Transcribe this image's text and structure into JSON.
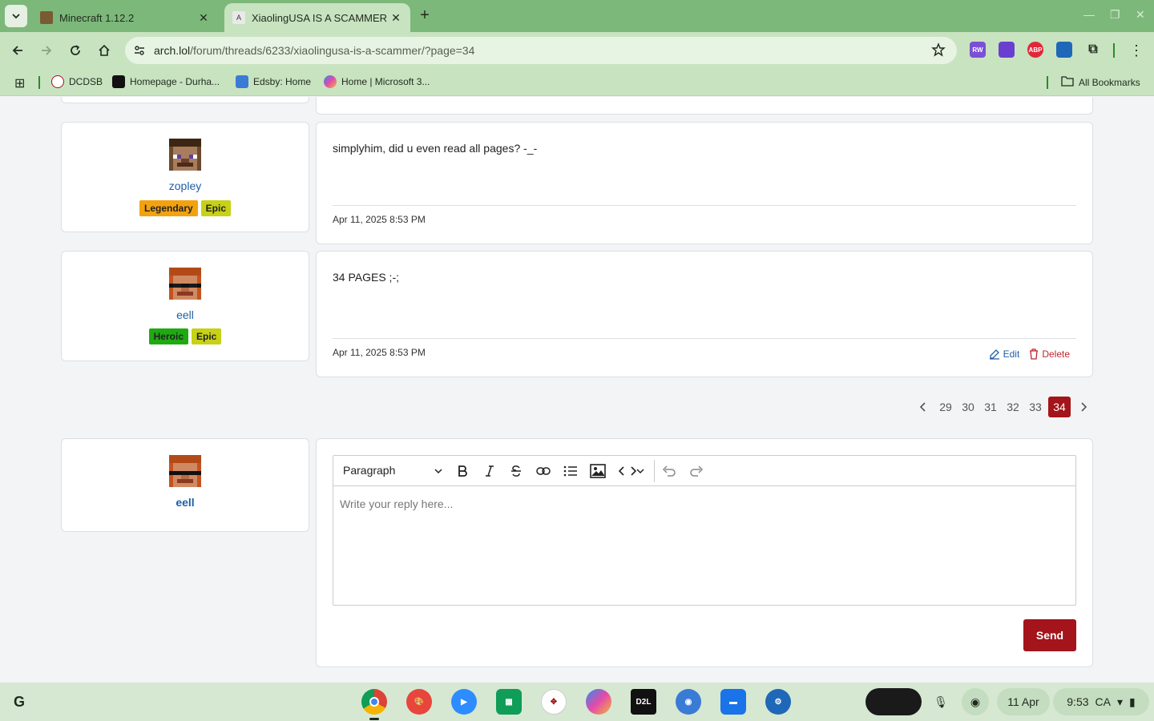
{
  "browser": {
    "tabs": [
      {
        "title": "Minecraft 1.12.2",
        "active": false
      },
      {
        "title": "XiaolingUSA IS A SCAMMER - A",
        "active": true
      }
    ],
    "url_host": "arch.lol",
    "url_path": "/forum/threads/6233/xiaolingusa-is-a-scammer/?page=34",
    "bookmarks": [
      "DCDSB",
      "Homepage - Durha...",
      "Edsby: Home",
      "Home | Microsoft 3..."
    ],
    "all_bookmarks_label": "All Bookmarks",
    "extensions": [
      "RW",
      "",
      "ABP",
      "",
      ""
    ]
  },
  "posts": [
    {
      "username": "zopley",
      "badges": [
        {
          "label": "Legendary",
          "color": "#f3a20f"
        },
        {
          "label": "Epic",
          "color": "#c7d115"
        }
      ],
      "text": "simplyhim, did u even read all pages? -_-",
      "date": "Apr 11, 2025 8:53 PM"
    },
    {
      "username": "eell",
      "badges": [
        {
          "label": "Heroic",
          "color": "#1faa12"
        },
        {
          "label": "Epic",
          "color": "#c7d115"
        }
      ],
      "text": "34 PAGES ;-;",
      "date": "Apr 11, 2025 8:53 PM",
      "edit_label": "Edit",
      "delete_label": "Delete"
    }
  ],
  "pagination": {
    "pages": [
      "29",
      "30",
      "31",
      "32",
      "33",
      "34"
    ],
    "current": "34"
  },
  "reply": {
    "username": "eell",
    "format_select": "Paragraph",
    "placeholder": "Write your reply here...",
    "send_label": "Send"
  },
  "shelf": {
    "apps": [
      "Chrome",
      "Palette",
      "Zoom",
      "Classroom",
      "DCDSB",
      "Copilot",
      "D2L",
      "Edsby",
      "Files",
      "Settings"
    ],
    "date": "11 Apr",
    "time": "9:53",
    "locale": "CA"
  }
}
